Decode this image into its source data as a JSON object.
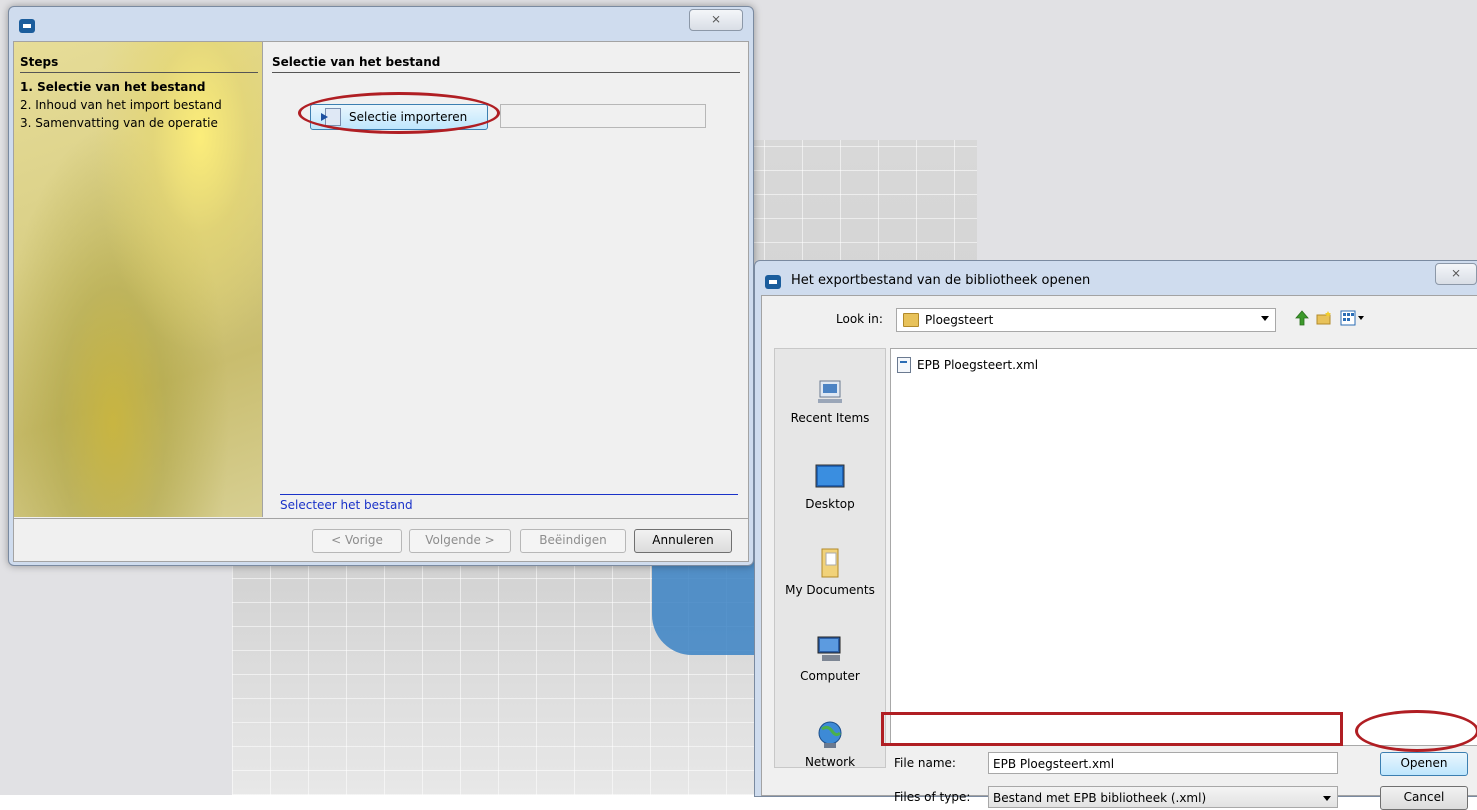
{
  "wizard": {
    "close_glyph": "⨯",
    "steps_title": "Steps",
    "steps": [
      "1. Selectie van het bestand",
      "2. Inhoud van het import bestand",
      "3. Samenvatting van de operatie"
    ],
    "active_step": 0,
    "main_title": "Selectie van het bestand",
    "import_button": "Selectie importeren",
    "status": "Selecteer het bestand",
    "buttons": {
      "previous": "< Vorige",
      "next": "Volgende >",
      "finish": "Beëindigen",
      "cancel": "Annuleren"
    }
  },
  "dialog": {
    "title": "Het exportbestand van de bibliotheek openen",
    "close_glyph": "⨯",
    "look_in_label": "Look in:",
    "look_in_value": "Ploegsteert",
    "places": [
      "Recent Items",
      "Desktop",
      "My Documents",
      "Computer",
      "Network"
    ],
    "files": [
      "EPB Ploegsteert.xml"
    ],
    "file_name_label": "File name:",
    "file_name_value": "EPB Ploegsteert.xml",
    "files_of_type_label": "Files of type:",
    "files_of_type_value": "Bestand met EPB bibliotheek (.xml)",
    "open_button": "Openen",
    "cancel_button": "Cancel"
  },
  "colors": {
    "annotation": "#b01e23",
    "status_text": "#1a32c8",
    "window_frame": "#cfdcee"
  }
}
